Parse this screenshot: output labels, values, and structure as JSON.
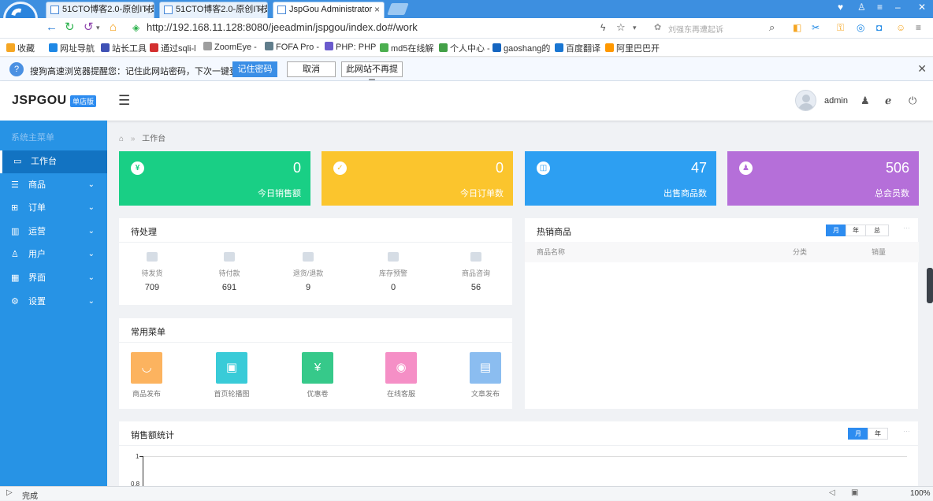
{
  "browser": {
    "tabs": [
      {
        "title": "51CTO博客2.0-原创IT技"
      },
      {
        "title": "51CTO博客2.0-原创IT技"
      },
      {
        "title": "JspGou Administrator"
      }
    ],
    "url": "http://192.168.11.128:8080/jeeadmin/jspgou/index.do#/work",
    "search_placeholder": "刘强东再遭起诉",
    "bookmarks": [
      {
        "label": "收藏",
        "color": "#f5a623"
      },
      {
        "label": "网址导航",
        "color": "#1e88e5"
      },
      {
        "label": "站长工具",
        "color": "#3f51b5"
      },
      {
        "label": "通过sqli-l",
        "color": "#d32f2f"
      },
      {
        "label": "ZoomEye -",
        "color": "#9e9e9e"
      },
      {
        "label": "FOFA Pro -",
        "color": "#607d8b"
      },
      {
        "label": "PHP: PHP",
        "color": "#6a5acd"
      },
      {
        "label": "md5在线解",
        "color": "#4caf50"
      },
      {
        "label": "个人中心 -",
        "color": "#43a047"
      },
      {
        "label": "gaoshang的",
        "color": "#1565c0"
      },
      {
        "label": "百度翻译",
        "color": "#1976d2"
      },
      {
        "label": "阿里巴巴开",
        "color": "#ff9800"
      }
    ],
    "password_bar": {
      "message": "搜狗高速浏览器提醒您：记住此网站密码，下次一键登录！",
      "save": "记住密码",
      "cancel": "取消",
      "never": "此网站不再提示"
    },
    "status": "完成",
    "zoom": "100%"
  },
  "header": {
    "brand": "JSPGOU",
    "edition": "单店版",
    "username": "admin"
  },
  "sidebar": {
    "title": "系统主菜单",
    "items": [
      {
        "label": "工作台",
        "icon": "monitor-icon",
        "glyph": "▭"
      },
      {
        "label": "商品",
        "icon": "list-icon",
        "glyph": "☰"
      },
      {
        "label": "订单",
        "icon": "grid-icon",
        "glyph": "⊞"
      },
      {
        "label": "运营",
        "icon": "bar-chart-icon",
        "glyph": "▥"
      },
      {
        "label": "用户",
        "icon": "user-icon",
        "glyph": "♙"
      },
      {
        "label": "界面",
        "icon": "layout-icon",
        "glyph": "▦"
      },
      {
        "label": "设置",
        "icon": "gear-icon",
        "glyph": "⚙"
      }
    ]
  },
  "breadcrumb": "工作台",
  "stats": [
    {
      "value": "0",
      "label": "今日销售额",
      "icon": "yen-icon",
      "glyph": "¥",
      "color": "#19cf85"
    },
    {
      "value": "0",
      "label": "今日订单数",
      "icon": "clipboard-icon",
      "glyph": "✓",
      "color": "#fbc52d"
    },
    {
      "value": "47",
      "label": "出售商品数",
      "icon": "bag-icon",
      "glyph": "◫",
      "color": "#2d9ff2"
    },
    {
      "value": "506",
      "label": "总会员数",
      "icon": "person-icon",
      "glyph": "♟",
      "color": "#b56fd9"
    }
  ],
  "pending": {
    "title": "待处理",
    "items": [
      {
        "label": "待发货",
        "value": "709",
        "icon": "truck-icon"
      },
      {
        "label": "待付款",
        "value": "691",
        "icon": "wallet-icon"
      },
      {
        "label": "退货/退款",
        "value": "9",
        "icon": "refund-icon"
      },
      {
        "label": "库存预警",
        "value": "0",
        "icon": "warning-icon"
      },
      {
        "label": "商品咨询",
        "value": "56",
        "icon": "chat-icon"
      }
    ]
  },
  "quick_menu": {
    "title": "常用菜单",
    "items": [
      {
        "label": "商品发布",
        "icon": "bag-icon",
        "glyph": "◡",
        "color": "#fcb35f"
      },
      {
        "label": "首页轮播图",
        "icon": "image-icon",
        "glyph": "▣",
        "color": "#39cbd8"
      },
      {
        "label": "优惠卷",
        "icon": "coupon-icon",
        "glyph": "¥",
        "color": "#36c98a"
      },
      {
        "label": "在线客服",
        "icon": "support-icon",
        "glyph": "◉",
        "color": "#f58fc6"
      },
      {
        "label": "文章发布",
        "icon": "document-icon",
        "glyph": "▤",
        "color": "#8bbdf0"
      }
    ]
  },
  "hot_products": {
    "title": "热销商品",
    "periods": [
      "月",
      "年",
      "总"
    ],
    "columns": [
      "商品名称",
      "分类",
      "销量"
    ]
  },
  "sales_stats": {
    "title": "销售额统计",
    "periods": [
      "月",
      "年"
    ],
    "y_ticks": [
      "1",
      "0.8"
    ]
  }
}
